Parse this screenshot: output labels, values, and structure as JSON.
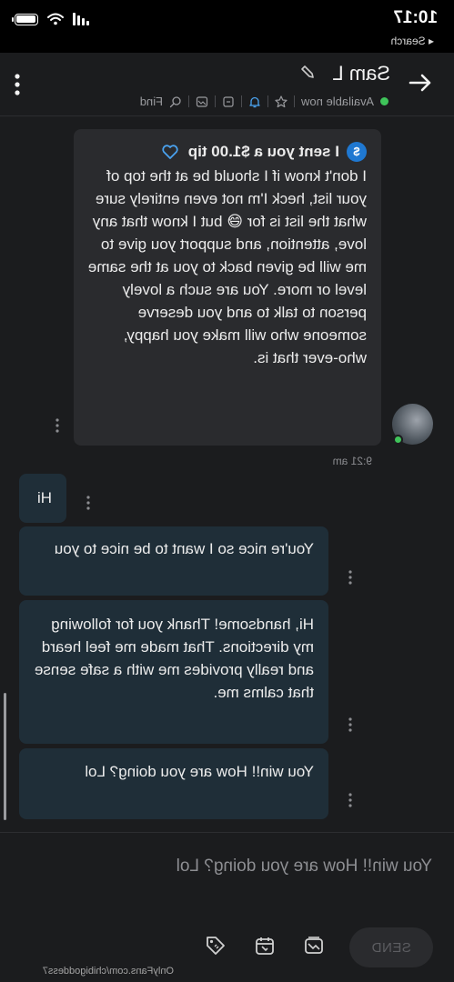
{
  "status": {
    "time": "10:17",
    "back_label": "◂ Search"
  },
  "header": {
    "user_name": "Sam L",
    "presence": "Available now",
    "find_label": "Find"
  },
  "messages": {
    "tip_title": "I sent you a $1.00 tip",
    "tip_text": "I don't know if I should be at the top of your list, heck I'm not even entirely sure what the list is for 😅 but I know that any love, attention, and support you give to me will be given back to you at the same level or more. You are such a lovely person to talk to and you deserve someone who will make you happy, who-ever that is.",
    "tip_time": "9:21 am",
    "m1": "Hi",
    "m2": "You're nice so I want to be nice to you",
    "m3": "Hi, handsome! Thank you for following my directions. That made me feel heard and really provides me with a safe sense that calms me.",
    "m4": "You win!! How are you doing? Lol"
  },
  "composer": {
    "draft": "You win!!  How are you doing? Lol",
    "send_label": "SEND",
    "watermark": "OnlyFans.com/chibigoddess7"
  },
  "colors": {
    "online": "#3fc45a",
    "tip_badge": "#1f78d1",
    "heart": "#4aa3f0",
    "outgoing_bubble": "#1f2e38",
    "incoming_bubble": "#2a2b2e"
  }
}
